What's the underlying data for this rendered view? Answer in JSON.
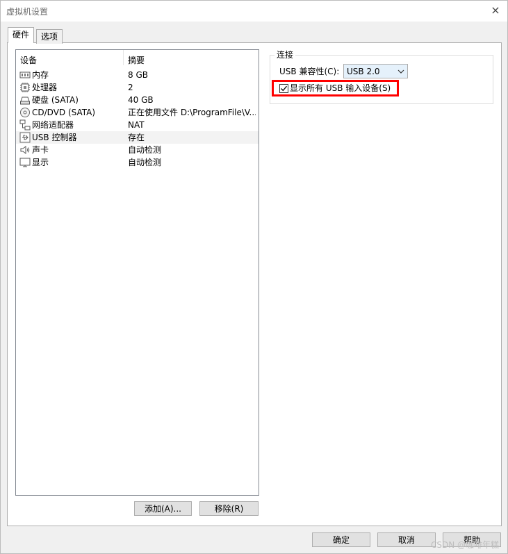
{
  "window": {
    "title": "虚拟机设置",
    "close_symbol": "×"
  },
  "tabs": [
    {
      "label": "硬件",
      "active": true
    },
    {
      "label": "选项",
      "active": false
    }
  ],
  "device_list": {
    "headers": {
      "device": "设备",
      "summary": "摘要"
    },
    "rows": [
      {
        "icon": "memory-icon",
        "name": "内存",
        "value": "8 GB",
        "selected": false
      },
      {
        "icon": "processor-icon",
        "name": "处理器",
        "value": "2",
        "selected": false
      },
      {
        "icon": "hard-disk-icon",
        "name": "硬盘 (SATA)",
        "value": "40 GB",
        "selected": false
      },
      {
        "icon": "cd-dvd-icon",
        "name": "CD/DVD (SATA)",
        "value": "正在使用文件 D:\\ProgramFile\\V...",
        "selected": false
      },
      {
        "icon": "network-adapter-icon",
        "name": "网络适配器",
        "value": "NAT",
        "selected": false
      },
      {
        "icon": "usb-controller-icon",
        "name": "USB 控制器",
        "value": "存在",
        "selected": true
      },
      {
        "icon": "sound-card-icon",
        "name": "声卡",
        "value": "自动检测",
        "selected": false
      },
      {
        "icon": "display-icon",
        "name": "显示",
        "value": "自动检测",
        "selected": false
      }
    ]
  },
  "list_buttons": {
    "add": "添加(A)...",
    "remove": "移除(R)"
  },
  "connection": {
    "legend": "连接",
    "compat_label": "USB 兼容性(C):",
    "compat_value": "USB 2.0",
    "show_all_label": "显示所有 USB 输入设备(S)",
    "show_all_checked": true,
    "highlight_color": "#ff0000"
  },
  "footer": {
    "ok": "确定",
    "cancel": "取消",
    "help": "帮助"
  },
  "watermark": "CSDN @咖啡年糕"
}
